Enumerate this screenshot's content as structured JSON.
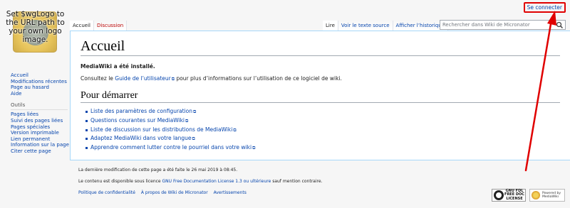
{
  "logo": {
    "text": "Set $wgLogo to the URL path to your own logo image."
  },
  "personal": {
    "login": "Se connecter"
  },
  "sidebar": {
    "nav": [
      "Accueil",
      "Modifications récentes",
      "Page au hasard",
      "Aide"
    ],
    "tools_heading": "Outils",
    "tools": [
      "Pages liées",
      "Suivi des pages liées",
      "Pages spéciales",
      "Version imprimable",
      "Lien permanent",
      "Information sur la page",
      "Citer cette page"
    ]
  },
  "tabs": {
    "left": [
      "Accueil",
      "Discussion"
    ],
    "right": [
      "Lire",
      "Voir le texte source",
      "Afficher l’historique"
    ]
  },
  "search": {
    "placeholder": "Rechercher dans Wiki de Micronator"
  },
  "content": {
    "title": "Accueil",
    "installed": "MediaWiki a été installé.",
    "intro_before": "Consultez le ",
    "intro_link": "Guide de l’utilisateur",
    "intro_after": " pour plus d’informations sur l’utilisation de ce logiciel de wiki.",
    "section": "Pour démarrer",
    "links": [
      "Liste des paramètres de configuration",
      "Questions courantes sur MediaWiki",
      "Liste de discussion sur les distributions de MediaWiki",
      "Adaptez MediaWiki dans votre langue",
      "Apprendre comment lutter contre le pourriel dans votre wiki"
    ]
  },
  "footer": {
    "lastmod": "La dernière modification de cette page a été faite le 26 mai 2019 à 08:45.",
    "license_before": "Le contenu est disponible sous licence ",
    "license_link": "GNU Free Documentation License 1.3 ou ultérieure",
    "license_after": " sauf mention contraire.",
    "links": [
      "Politique de confidentialité",
      "À propos de Wiki de Micronator",
      "Avertissements"
    ],
    "gfdl": [
      "GNU FDL",
      "FREE DOC",
      "LICENSE"
    ],
    "mw": [
      "Powered by",
      "MediaWiki"
    ]
  },
  "colors": {
    "link": "#0645ad",
    "new_link": "#ba0000",
    "annotation": "#e00000"
  }
}
